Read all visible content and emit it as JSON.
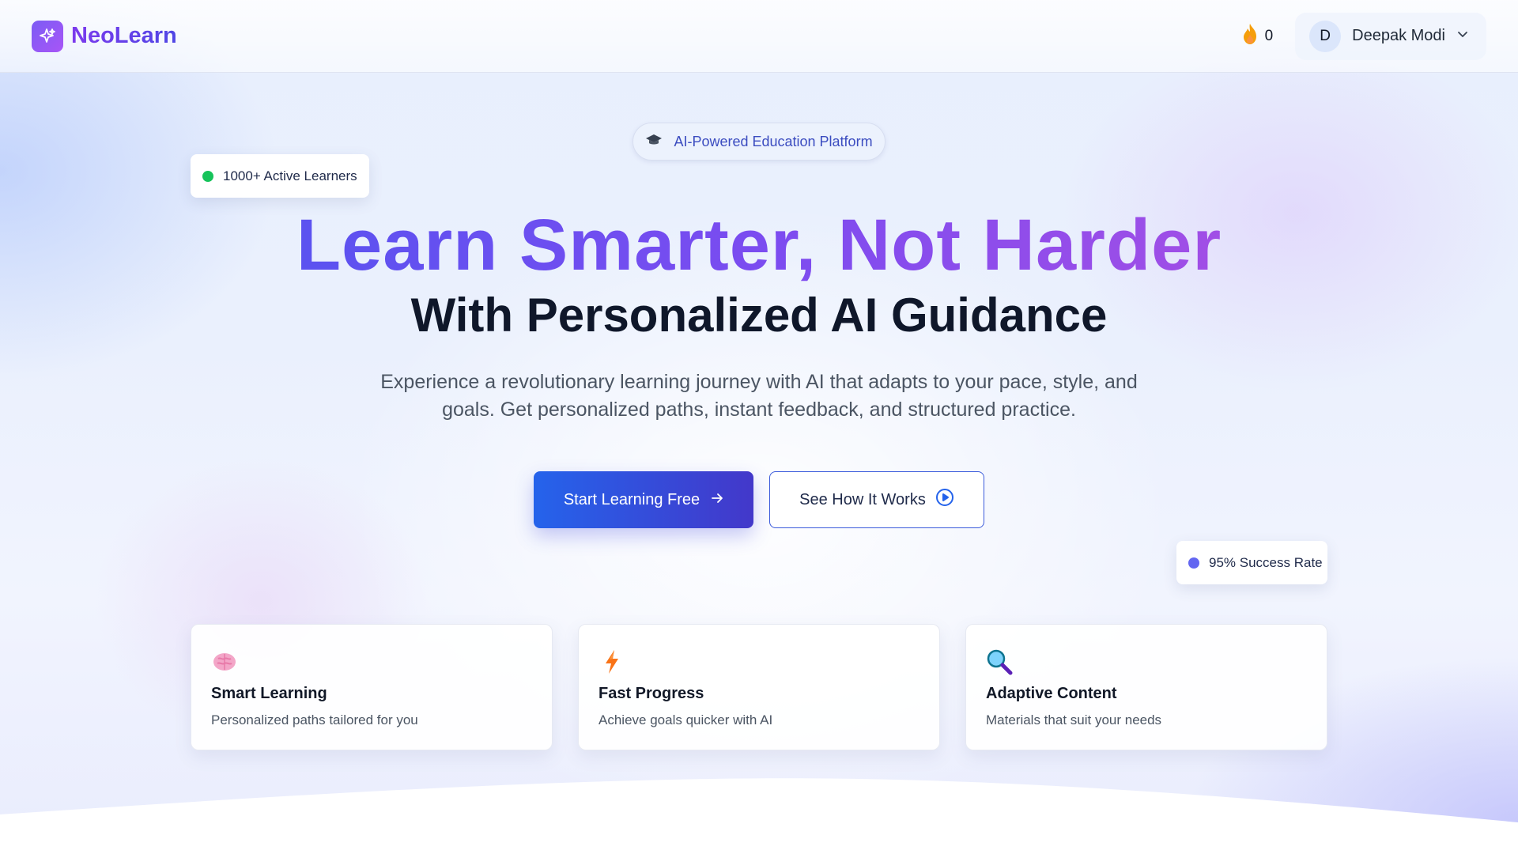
{
  "brand": {
    "name": "NeoLearn",
    "logo_icon": "sparkle-icon"
  },
  "nav": {
    "streak_icon": "flame-icon",
    "streak_count": "0",
    "user": {
      "initial": "D",
      "name": "Deepak Modi",
      "menu_icon": "chevron-down-icon"
    }
  },
  "hero": {
    "pill_label": "AI-Powered Education Platform",
    "pill_icon": "graduation-cap-icon",
    "badge_learners": "1000+ Active Learners",
    "badge_success": "95% Success Rate",
    "title_line1": "Learn Smarter, Not Harder",
    "title_line2": "With Personalized AI Guidance",
    "subtitle": "Experience a revolutionary learning journey with AI that adapts to your pace, style, and goals. Get personalized paths, instant feedback, and structured practice.",
    "primary_cta": "Start Learning Free",
    "secondary_cta": "See How It Works"
  },
  "features": [
    {
      "icon": "brain-icon",
      "title": "Smart Learning",
      "desc": "Personalized paths tailored for you"
    },
    {
      "icon": "lightning-icon",
      "title": "Fast Progress",
      "desc": "Achieve goals quicker with AI"
    },
    {
      "icon": "magnifier-icon",
      "title": "Adaptive Content",
      "desc": "Materials that suit your needs"
    }
  ],
  "colors": {
    "accent_blue": "#2563eb",
    "accent_indigo": "#4338ca",
    "accent_purple": "#a855f7",
    "status_green": "#16c35a",
    "status_violet": "#6366f1"
  }
}
